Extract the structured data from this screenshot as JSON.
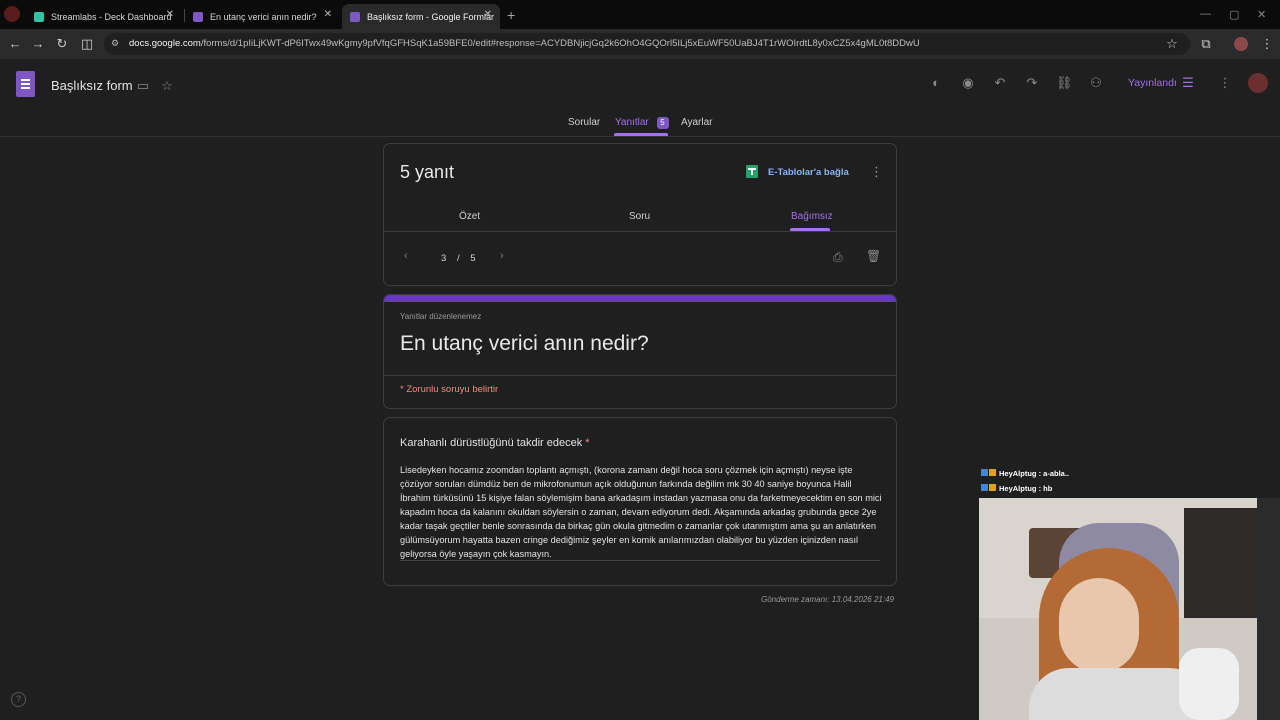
{
  "browser": {
    "tabs": [
      {
        "label": "Streamlabs - Deck Dashboard",
        "active": false
      },
      {
        "label": "En utanç verici anın nedir?",
        "active": false
      },
      {
        "label": "Başlıksız form - Google Formlar",
        "active": true
      }
    ],
    "new_tab": "+",
    "url_host": "docs.google.com",
    "url_path": "/forms/d/1pIiLjKWT-dP6ITwx49wKgmy9pfVfqGFHSqK1a59BFE0/edit#response=ACYDBNjicjGq2k6OhO4GQOrl5ILj5xEuWF50UaBJ4T1rWOIrdtL8y0xCZ5x4gML0t8DDwU"
  },
  "app": {
    "form_title": "Başlıksız form",
    "publish_label": "Yayınlandı",
    "tabs": [
      {
        "label": "Sorular",
        "active": false
      },
      {
        "label": "Yanıtlar",
        "active": true,
        "badge": "5"
      },
      {
        "label": "Ayarlar",
        "active": false
      }
    ],
    "accent": "#a66ef2",
    "brand": "#7e57c2"
  },
  "responses": {
    "count_label": "5 yanıt",
    "sheets_label": "E-Tablolar'a bağla",
    "views": [
      {
        "label": "Özet",
        "active": false
      },
      {
        "label": "Soru",
        "active": false
      },
      {
        "label": "Bağımsız",
        "active": true
      }
    ],
    "pager": {
      "current": "3",
      "separator": "/",
      "total": "5"
    }
  },
  "form_header": {
    "note": "Yanıtlar düzenlenemez",
    "title": "En utanç verici anın nedir?",
    "required_note": "* Zorunlu soruyu belirtir"
  },
  "question": {
    "label": "Karahanlı dürüstlüğünü takdir edecek",
    "required_mark": "*",
    "answer": "Lisedeyken hocamız zoomdan toplantı açmıştı,  (korona zamanı değil hoca soru çözmek için açmıştı) neyse işte çözüyor soruları dümdüz ben de mikrofonumun açık olduğunun farkında değilim mk 30 40 saniye boyunca Halil İbrahim türküsünü 15 kişiye falan söylemişim bana arkadaşım instadan yazmasa onu da farketmeyecektim en son mici kapadım hoca da kalanını okuldan söylersin o zaman, devam ediyorum dedi. Akşamında arkadaş grubunda gece 2ye kadar taşak geçtiler benle sonrasında da  birkaç gün okula gitmedim o zamanlar çok utanmıştım ama şu an anlatırken gülümsüyorum hayatta bazen cringe dediğimiz şeyler en komik anılarımızdan olabiliyor bu yüzden içinizden nasıl geliyorsa öyle yaşayın çok kasmayın."
  },
  "submitted": "Gönderme zamanı: 13.04.2026 21:49",
  "chat": [
    {
      "user": "HeyAlptug",
      "text": "a-abla.."
    },
    {
      "user": "HeyAlptug",
      "text": "hb"
    }
  ]
}
